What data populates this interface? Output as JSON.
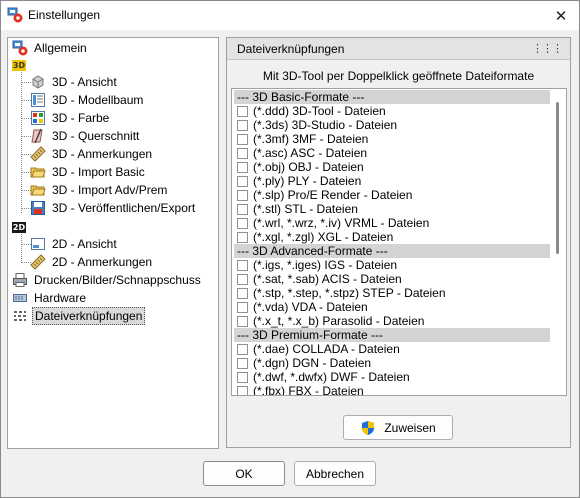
{
  "window": {
    "title": "Einstellungen"
  },
  "tree": {
    "items": [
      {
        "label": "Allgemein"
      },
      {
        "label": "3D"
      },
      {
        "label": "3D - Ansicht"
      },
      {
        "label": "3D - Modellbaum"
      },
      {
        "label": "3D - Farbe"
      },
      {
        "label": "3D - Querschnitt"
      },
      {
        "label": "3D - Anmerkungen"
      },
      {
        "label": "3D - Import Basic"
      },
      {
        "label": "3D - Import Adv/Prem"
      },
      {
        "label": "3D - Veröffentlichen/Export"
      },
      {
        "label": "2D"
      },
      {
        "label": "2D - Ansicht"
      },
      {
        "label": "2D - Anmerkungen"
      },
      {
        "label": "Drucken/Bilder/Schnappschuss"
      },
      {
        "label": "Hardware"
      },
      {
        "label": "Dateiverknüpfungen"
      }
    ],
    "selected": "Dateiverknüpfungen"
  },
  "panel": {
    "title": "Dateiverknüpfungen",
    "subtitle": "Mit 3D-Tool per Doppelklick geöffnete Dateiformate",
    "rows": [
      {
        "label": "--- 3D Basic-Formate ---",
        "group": true
      },
      {
        "label": "(*.ddd) 3D-Tool - Dateien",
        "checked": false
      },
      {
        "label": "(*.3ds) 3D-Studio - Dateien",
        "checked": false
      },
      {
        "label": "(*.3mf) 3MF - Dateien",
        "checked": false
      },
      {
        "label": "(*.asc) ASC - Dateien",
        "checked": false
      },
      {
        "label": "(*.obj) OBJ - Dateien",
        "checked": false
      },
      {
        "label": "(*.ply) PLY - Dateien",
        "checked": false
      },
      {
        "label": "(*.slp) Pro/E Render - Dateien",
        "checked": false
      },
      {
        "label": "(*.stl) STL - Dateien",
        "checked": false
      },
      {
        "label": "(*.wrl, *.wrz, *.iv) VRML - Dateien",
        "checked": false
      },
      {
        "label": "(*.xgl, *.zgl) XGL - Dateien",
        "checked": false
      },
      {
        "label": "--- 3D Advanced-Formate ---",
        "group": true
      },
      {
        "label": "(*.igs, *.iges) IGS - Dateien",
        "checked": false
      },
      {
        "label": "(*.sat, *.sab) ACIS - Dateien",
        "checked": false
      },
      {
        "label": "(*.stp, *.step, *.stpz) STEP - Dateien",
        "checked": false
      },
      {
        "label": "(*.vda) VDA - Dateien",
        "checked": false
      },
      {
        "label": "(*.x_t, *.x_b) Parasolid - Dateien",
        "checked": false
      },
      {
        "label": "--- 3D Premium-Formate ---",
        "group": true
      },
      {
        "label": "(*.dae) COLLADA - Dateien",
        "checked": false
      },
      {
        "label": "(*.dgn) DGN - Dateien",
        "checked": false
      },
      {
        "label": "(*.dwf, *.dwfx) DWF - Dateien",
        "checked": false
      },
      {
        "label": "(*.fbx) FBX - Dateien",
        "checked": false
      }
    ],
    "assign_label": "Zuweisen"
  },
  "footer": {
    "ok_label": "OK",
    "cancel_label": "Abbrechen"
  },
  "colors": {
    "accent": "#1e6fd9",
    "badge3d": "#f2c200",
    "badge2d": "#1a1a1a",
    "group_bg": "#d4d4d4"
  }
}
